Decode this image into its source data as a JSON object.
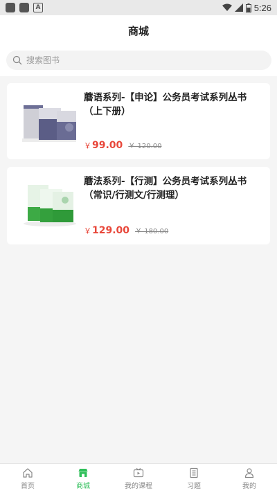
{
  "status_bar": {
    "time": "5:26"
  },
  "header": {
    "title": "商城"
  },
  "search": {
    "placeholder": "搜索图书"
  },
  "books": [
    {
      "title": "蘑语系列-【申论】公务员考试系列丛书（上下册）",
      "currency": "￥",
      "price": "99.00",
      "original_price": "￥ 120.00"
    },
    {
      "title": "蘑法系列-【行测】公务员考试系列丛书（常识/行测文/行测理）",
      "currency": "￥",
      "price": "129.00",
      "original_price": "￥ 180.00"
    }
  ],
  "tabs": [
    {
      "label": "首页",
      "icon": "home-icon",
      "active": false
    },
    {
      "label": "商城",
      "icon": "shop-icon",
      "active": true
    },
    {
      "label": "我的课程",
      "icon": "course-video-icon",
      "active": false
    },
    {
      "label": "习题",
      "icon": "exercise-list-icon",
      "active": false
    },
    {
      "label": "我的",
      "icon": "profile-icon",
      "active": false
    }
  ],
  "colors": {
    "accent": "#2fbf5a",
    "price": "#e8473a"
  }
}
